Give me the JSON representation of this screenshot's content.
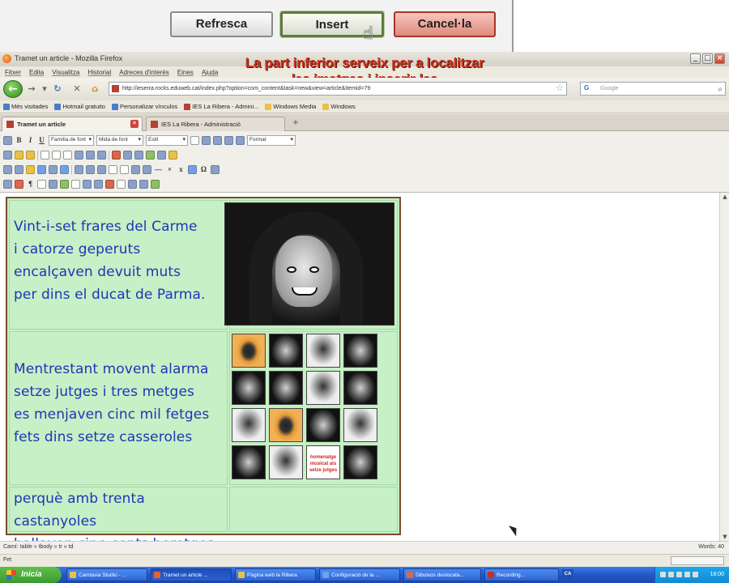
{
  "dialog": {
    "refresh_label": "Refresca",
    "insert_label": "Insert",
    "cancel_label": "Cancel·la"
  },
  "window": {
    "title": "Tramet un article - Mozilla Firefox"
  },
  "annotation": {
    "line1": "La part inferior serveix per a localitzar",
    "line2": "les imatges i inserir-les"
  },
  "menu": [
    "Fitxer",
    "Edita",
    "Visualitza",
    "Historial",
    "Adreces d'interès",
    "Eines",
    "Ajuda"
  ],
  "address": {
    "url": "http://ieserra.rocks.eduweb.cat/index.php?option=com_content&task=new&view=article&Itemid=79",
    "search_placeholder": "Google"
  },
  "bookmarks": [
    "Més visitades",
    "Hotmail gratuito",
    "Personalizar vínculos",
    "IES La Ribera - Admini...",
    "Windows Media",
    "Windows"
  ],
  "tabs": [
    {
      "label": "Tramet un article"
    },
    {
      "label": "IES La Ribera - Administració"
    }
  ],
  "toolbar": {
    "font_family": "Família de font",
    "font_size": "Mida de font",
    "style": "Estil",
    "format": "Format"
  },
  "content": {
    "stanza1": [
      "Vint-i-set frares del Carme",
      "i catorze geperuts",
      "encalçaven devuit muts",
      "per dins el ducat de Parma."
    ],
    "stanza2": [
      "Mentrestant movent alarma",
      "setze jutges i tres metges",
      "es menjaven cinc mil fetges",
      "fets dins setze casseroles"
    ],
    "stanza3": [
      "perquè amb trenta castanyoles",
      "ballaven cinc-cents heretges."
    ],
    "poster_caption": "homenatge musical als setze jutges"
  },
  "statusbar": {
    "path": "Camí: table » tbody » tr » td",
    "words": "Words: 40",
    "status": "Fet"
  },
  "taskbar": {
    "start": "Inicia",
    "tasks": [
      "Camtasia Studio - ...",
      "Tramet un article ...",
      "Pàgina web la Ribera",
      "Configuració de la ...",
      "Dibuixos deslocata...",
      "Recording..."
    ],
    "lang": "CA",
    "clock": "18:00"
  }
}
